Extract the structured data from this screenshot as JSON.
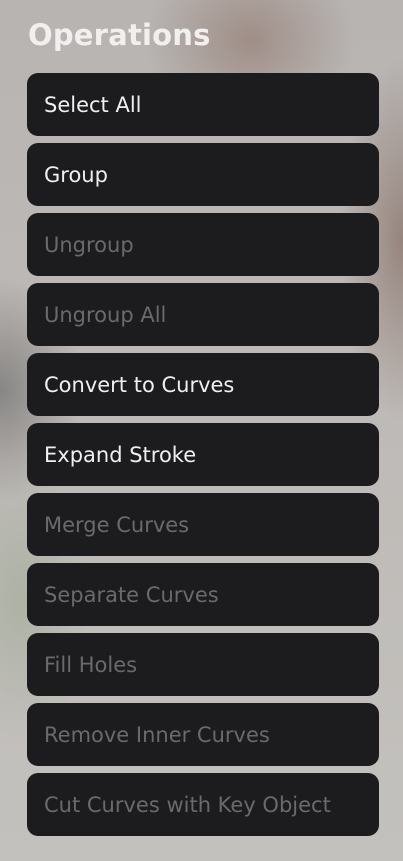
{
  "panel": {
    "title": "Operations"
  },
  "operations": [
    {
      "label": "Select All",
      "enabled": true
    },
    {
      "label": "Group",
      "enabled": true
    },
    {
      "label": "Ungroup",
      "enabled": false
    },
    {
      "label": "Ungroup All",
      "enabled": false
    },
    {
      "label": "Convert to Curves",
      "enabled": true
    },
    {
      "label": "Expand Stroke",
      "enabled": true
    },
    {
      "label": "Merge Curves",
      "enabled": false
    },
    {
      "label": "Separate Curves",
      "enabled": false
    },
    {
      "label": "Fill Holes",
      "enabled": false
    },
    {
      "label": "Remove Inner Curves",
      "enabled": false
    },
    {
      "label": "Cut Curves with Key Object",
      "enabled": false
    }
  ],
  "colors": {
    "button_bg": "#1c1c1e",
    "enabled_text": "#efefef",
    "disabled_text": "#6a6a6c",
    "title_text": "#f2f0ee"
  }
}
